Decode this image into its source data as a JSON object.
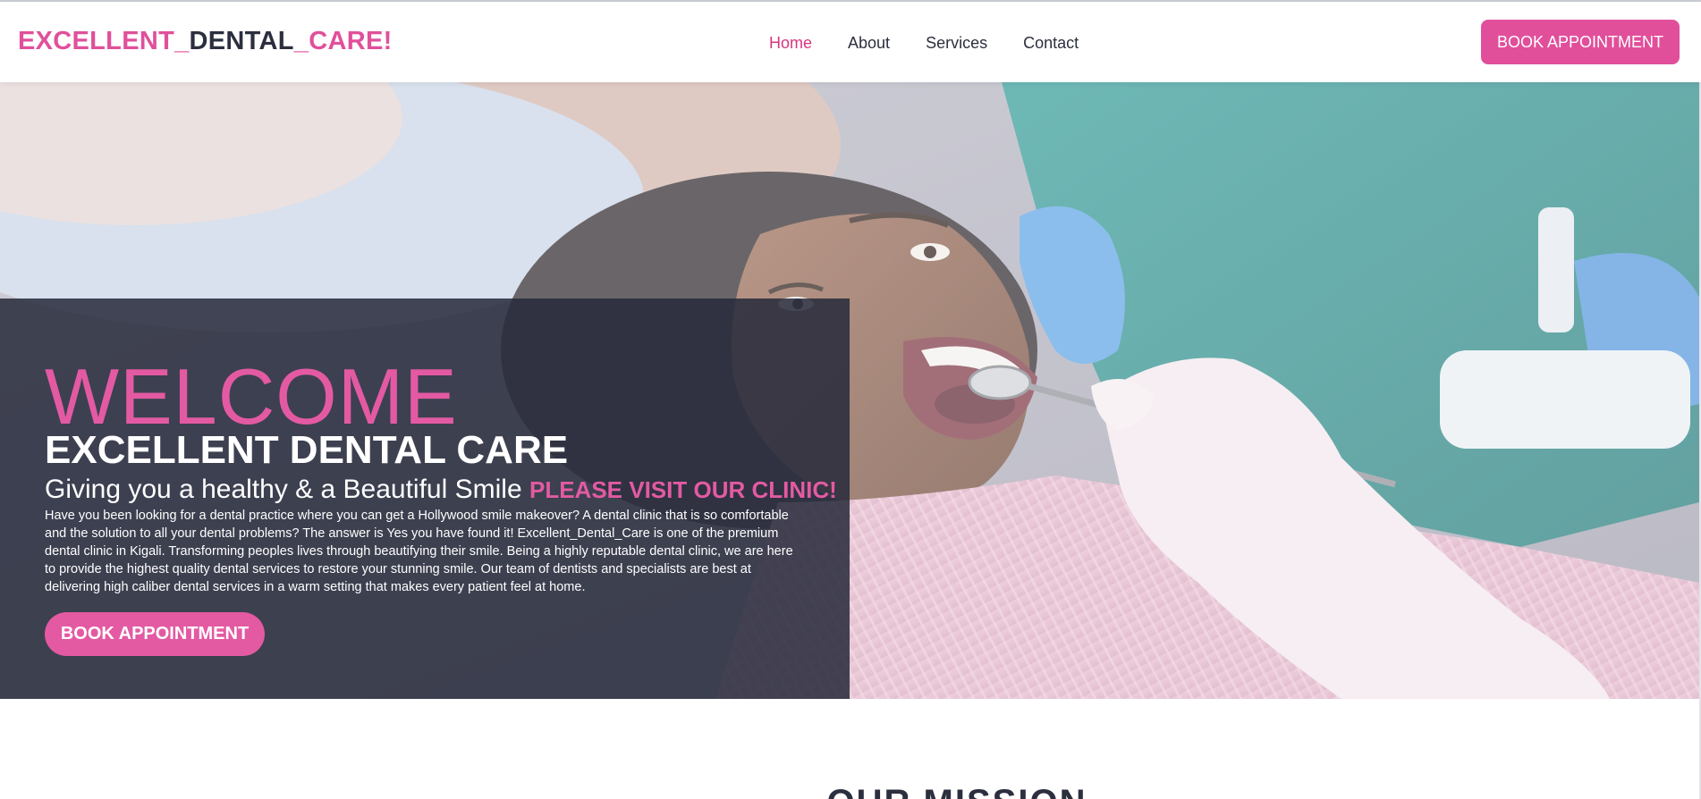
{
  "header": {
    "logo": {
      "part1": "EXCELLENT_",
      "part2": "DENTAL",
      "part3": "_CARE!"
    },
    "nav": [
      {
        "label": "Home",
        "active": true
      },
      {
        "label": "About",
        "active": false
      },
      {
        "label": "Services",
        "active": false
      },
      {
        "label": "Contact",
        "active": false
      }
    ],
    "cta_label": "BOOK APPOINTMENT"
  },
  "hero": {
    "welcome": "WELCOME",
    "title": "EXCELLENT DENTAL CARE",
    "tagline": "Giving you a healthy & a Beautiful Smile",
    "tagline_highlight": "PLEASE VISIT OUR CLINIC!",
    "paragraph": "Have you been looking for a dental practice where you can get a Hollywood smile makeover? A dental clinic that is so comfortable and the solution to all your dental problems? The answer is Yes you have found it! Excellent_Dental_Care is one of the premium dental clinic in Kigali. Transforming peoples lives through beautifying their smile. Being a highly reputable dental clinic, we are here to provide the highest quality dental services to restore your stunning smile. Our team of dentists and specialists are best at delivering high caliber dental services in a warm setting that makes every patient feel at home.",
    "cta_label": "BOOK APPOINTMENT",
    "image_alt_icon": "dental-patient-photo"
  },
  "mission": {
    "title": "OUR MISSION"
  },
  "colors": {
    "accent": "#e14f9b",
    "dark": "#2b2f3e",
    "panel": "#262a3a"
  }
}
